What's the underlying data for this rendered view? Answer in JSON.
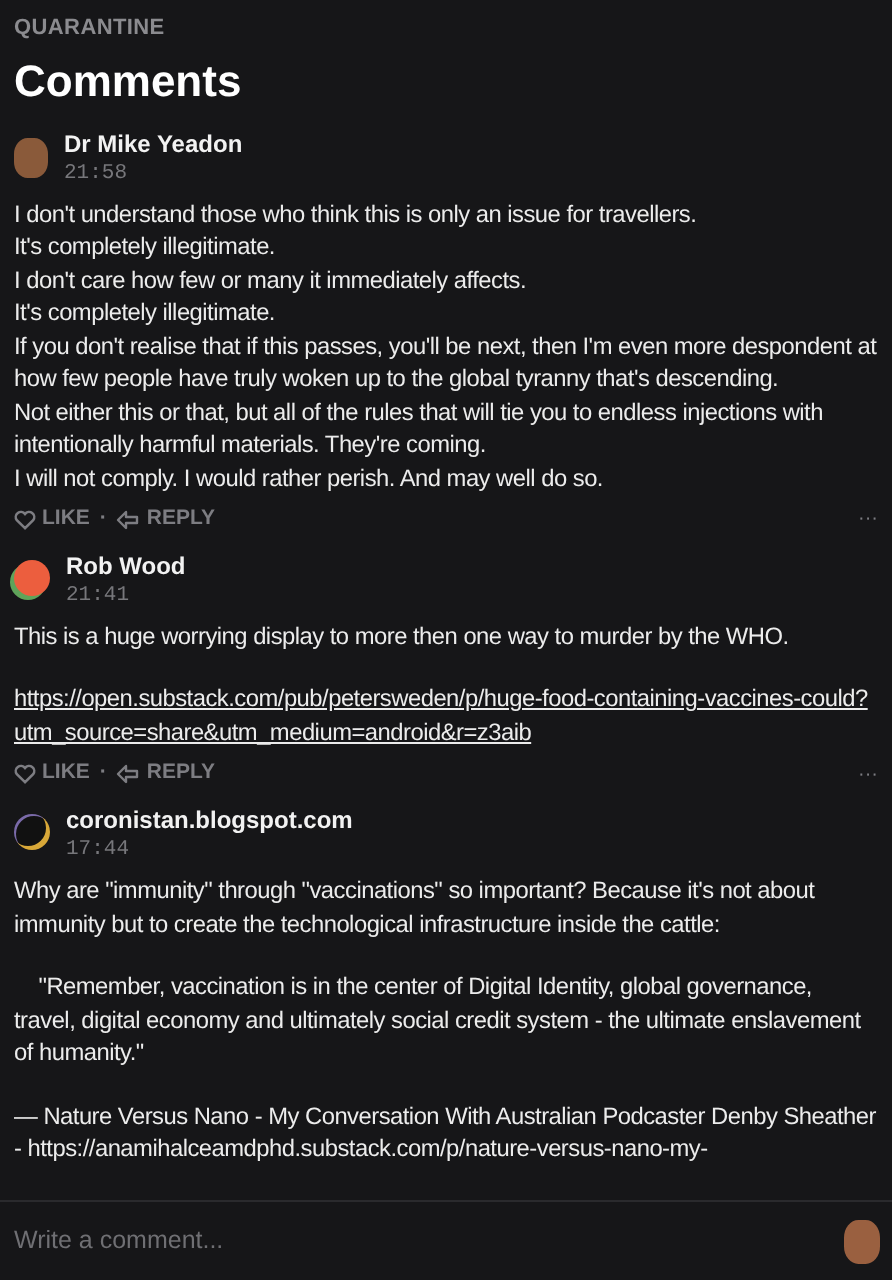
{
  "section": "QUARANTINE",
  "title": "Comments",
  "comments": [
    {
      "author": "Dr Mike Yeadon",
      "time": "21:58",
      "avatar": {
        "kind": "photo"
      },
      "paragraphs": [
        {
          "kind": "text",
          "text": "I don't understand those who think this is only an issue for travellers."
        },
        {
          "kind": "text",
          "text": "It's completely illegitimate."
        },
        {
          "kind": "text",
          "text": "I don't care how few or many it immediately affects."
        },
        {
          "kind": "text",
          "text": "It's completely illegitimate."
        },
        {
          "kind": "text",
          "text": "If you don't realise that if this passes, you'll be next, then I'm even more despondent at how few people have truly woken up to the global tyranny that's descending."
        },
        {
          "kind": "text",
          "text": "Not either this or that, but all of the rules that will tie you to endless injections with intentionally harmful materials. They're coming."
        },
        {
          "kind": "text",
          "text": "I will not comply. I would rather perish. And may well do so."
        }
      ],
      "actions": {
        "like": "LIKE",
        "separator": "·",
        "reply": "REPLY",
        "more": "···"
      }
    },
    {
      "author": "Rob Wood",
      "time": "21:41",
      "avatar": {
        "kind": "orange"
      },
      "paragraphs": [
        {
          "kind": "text",
          "text": "This is a huge worrying display to more then one way to murder by the WHO."
        },
        {
          "kind": "gap"
        },
        {
          "kind": "link",
          "text": "https://open.substack.com/pub/petersweden/p/huge-food-containing-vaccines-could?utm_source=share&utm_medium=android&r=z3aib"
        }
      ],
      "actions": {
        "like": "LIKE",
        "separator": "·",
        "reply": "REPLY",
        "more": "···"
      }
    },
    {
      "author": "coronistan.blogspot.com",
      "time": "17:44",
      "avatar": {
        "kind": "ring"
      },
      "paragraphs": [
        {
          "kind": "text",
          "text": "Why are \"immunity\" through \"vaccinations\" so important? Because it's not about immunity but to create the technological infrastructure inside the cattle:"
        },
        {
          "kind": "gap"
        },
        {
          "kind": "text",
          "text": "    \"Remember, vaccination is in the center of Digital Identity, global governance, travel, digital economy and ultimately social credit system - the ultimate enslavement of humanity.\""
        },
        {
          "kind": "gap"
        },
        {
          "kind": "source",
          "text": "— Nature Versus Nano - My Conversation With Australian Podcaster Denby Sheather - ",
          "link": "https://anamihalceamdphd.substack.com/p/nature-versus-nano-my-"
        }
      ]
    }
  ],
  "composer": {
    "placeholder": "Write a comment..."
  }
}
